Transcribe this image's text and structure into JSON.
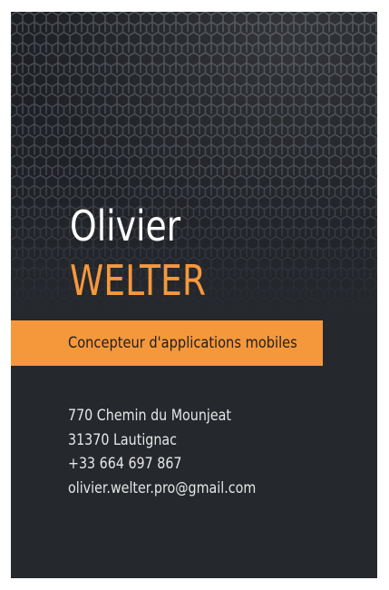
{
  "card": {
    "first_name": "Olivier",
    "last_name": "WELTER",
    "role": "Concepteur d'applications mobiles",
    "contact": {
      "street": "770 Chemin du Mounjeat",
      "city": "31370 Lautignac",
      "phone": "+33 664 697 867",
      "email": "olivier.welter.pro@gmail.com"
    }
  },
  "colors": {
    "background": "#25282d",
    "accent": "#f5983c",
    "text_light": "#ffffff"
  }
}
